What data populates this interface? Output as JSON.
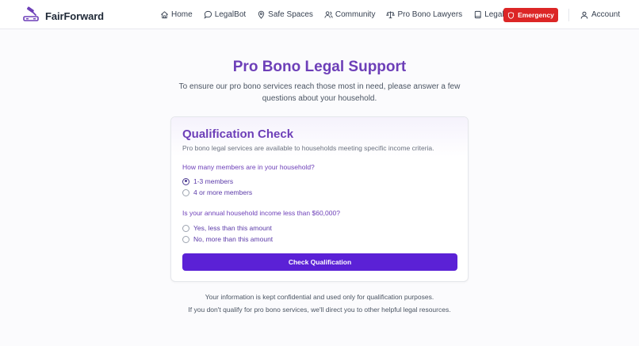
{
  "brand": {
    "name": "FairForward",
    "logo_icon": "gavel-scales-logo",
    "accent": "#6d3fb8"
  },
  "nav": {
    "links": [
      {
        "label": "Home",
        "icon": "home-icon"
      },
      {
        "label": "LegalBot",
        "icon": "chat-bubble-icon"
      },
      {
        "label": "Safe Spaces",
        "icon": "map-pin-icon"
      },
      {
        "label": "Community",
        "icon": "users-icon"
      },
      {
        "label": "Pro Bono Lawyers",
        "icon": "scales-icon"
      },
      {
        "label": "Legal Terms",
        "icon": "book-icon"
      }
    ],
    "emergency_label": "Emergency",
    "emergency_color": "#dc2626",
    "account_label": "Account"
  },
  "page": {
    "title": "Pro Bono Legal Support",
    "subtitle": "To ensure our pro bono services reach those most in need, please answer a few questions about your household."
  },
  "card": {
    "title": "Qualification Check",
    "description": "Pro bono legal services are available to households meeting specific income criteria.",
    "question1": {
      "label": "How many members are in your household?",
      "options": [
        "1-3 members",
        "4 or more members"
      ],
      "selected": 0
    },
    "question2": {
      "label": "Is your annual household income less than $60,000?",
      "options": [
        "Yes, less than this amount",
        "No, more than this amount"
      ],
      "selected": null
    },
    "submit_label": "Check Qualification",
    "submit_color": "#5b21d6"
  },
  "footer": {
    "note1": "Your information is kept confidential and used only for qualification purposes.",
    "note2": "If you don't qualify for pro bono services, we'll direct you to other helpful legal resources."
  }
}
